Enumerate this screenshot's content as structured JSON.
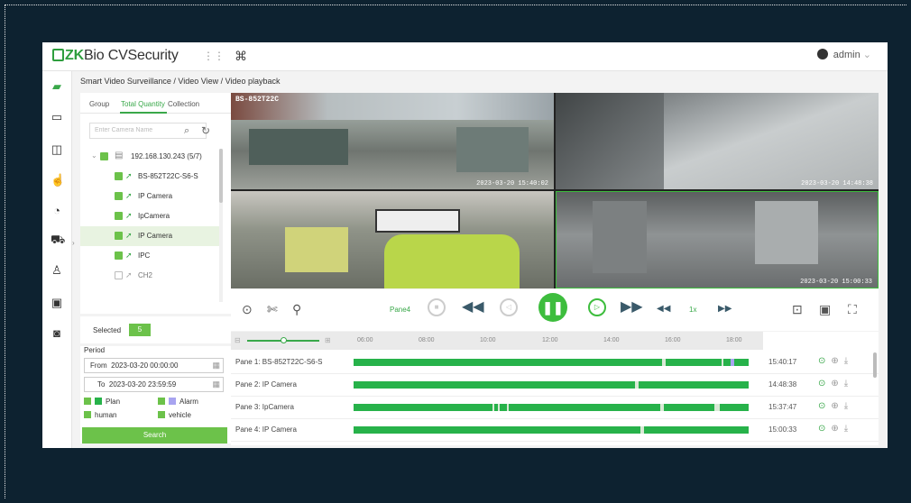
{
  "app": {
    "brand_zk": "ZK",
    "brand_rest": "Bio CVSecurity",
    "user": "admin"
  },
  "breadcrumb": "Smart Video Surveillance / Video View / Video playback",
  "tabs": [
    "Group",
    "Total Quantity",
    "Collection"
  ],
  "search_placeholder": "Enter Camera Name",
  "tree": {
    "root": "192.168.130.243 (5/7)",
    "items": [
      "BS-852T22C-S6-S",
      "IP Camera",
      "IpCamera",
      "IP Camera",
      "IPC",
      "CH2"
    ]
  },
  "selected": {
    "label": "Selected",
    "count": "5"
  },
  "period": {
    "label": "Period",
    "from_label": "From",
    "from_value": "2023-03-20 00:00:00",
    "to_label": "To",
    "to_value": "2023-03-20 23:59:59",
    "types": [
      "Plan",
      "Alarm",
      "human",
      "vehicle"
    ],
    "search_button": "Search"
  },
  "video": {
    "pane1_label": "BS-852T22C",
    "pane1_time": "2023-03-20 15:40:02",
    "pane2_time": "2023-03-20 14:48:38",
    "pane4_time": "2023-03-20 15:00:33"
  },
  "controls": {
    "pane": "Pane4",
    "speed": "1x"
  },
  "timeline": {
    "ticks": [
      "06:00",
      "08:00",
      "10:00",
      "12:00",
      "14:00",
      "16:00",
      "18:00"
    ],
    "rows": [
      {
        "name": "Pane 1: BS-852T22C-S6-S",
        "time": "15:40:17"
      },
      {
        "name": "Pane 2: IP Camera",
        "time": "14:48:38"
      },
      {
        "name": "Pane 3: IpCamera",
        "time": "15:37:47"
      },
      {
        "name": "Pane 4: IP Camera",
        "time": "15:00:33"
      }
    ]
  },
  "colors": {
    "accent": "#3dbd3d",
    "playback_bar": "#27b24a",
    "background": "#0d2230"
  }
}
